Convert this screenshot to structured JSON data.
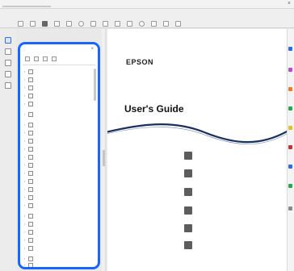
{
  "window": {
    "title": "",
    "controls": "× "
  },
  "menus": [
    "",
    "",
    ""
  ],
  "document": {
    "brand": "EPSON",
    "subtitle": "",
    "title": "User's Guide",
    "toc": [
      "",
      "",
      "",
      "",
      "",
      ""
    ]
  },
  "bookmarks": {
    "header": "",
    "close": "×",
    "items": [
      "",
      "",
      "",
      "",
      "",
      "",
      "",
      "",
      "",
      "",
      "",
      "",
      "",
      "",
      "",
      "",
      "",
      "",
      "",
      "",
      "",
      "",
      "",
      "",
      "",
      ""
    ]
  },
  "colors": {
    "highlight": "#1766ff",
    "rail_dots": [
      "#2d6be4",
      "#b64cc8",
      "#e87c2b",
      "#2ea44f",
      "#e1c12b",
      "#c8313b",
      "#2d6be4",
      "#8a8a8a"
    ]
  },
  "icons": {
    "bookmark_page": "page-icon",
    "expander": "expand-arrow-icon",
    "toc_item": "section-icon"
  }
}
